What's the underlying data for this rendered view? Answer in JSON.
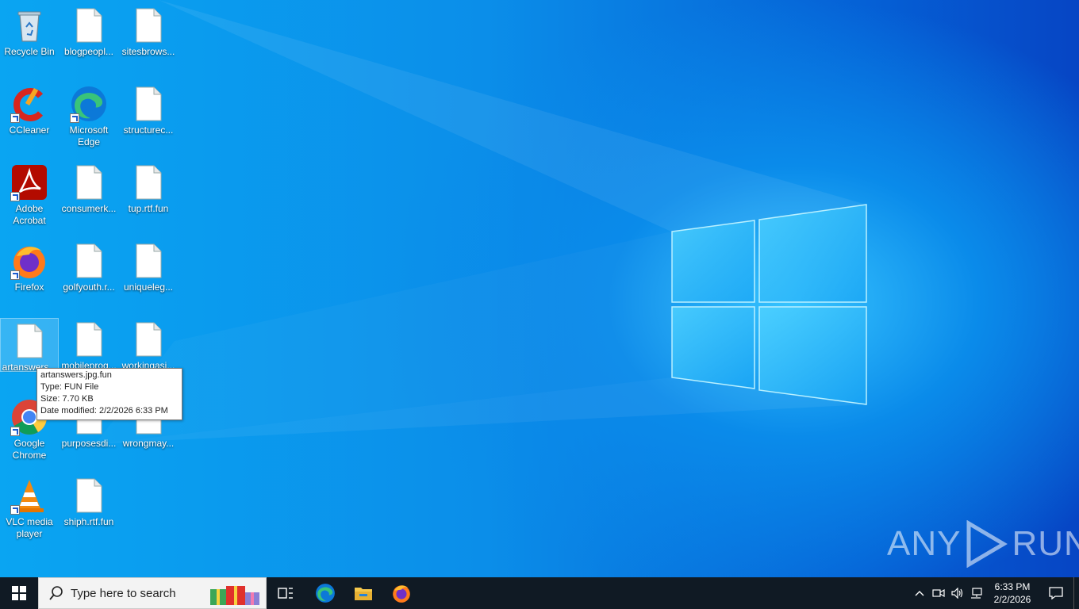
{
  "desktop": {
    "icons": [
      {
        "label": "Recycle Bin"
      },
      {
        "label": "blogpeopl..."
      },
      {
        "label": "sitesbrows..."
      },
      {
        "label": "CCleaner"
      },
      {
        "label": "Microsoft Edge"
      },
      {
        "label": "structurec..."
      },
      {
        "label": "Adobe Acrobat"
      },
      {
        "label": "consumerk..."
      },
      {
        "label": "tup.rtf.fun"
      },
      {
        "label": "Firefox"
      },
      {
        "label": "golfyouth.r..."
      },
      {
        "label": "uniqueleg..."
      },
      {
        "label": "artanswers..."
      },
      {
        "label": "mobileprog..."
      },
      {
        "label": "workingasi..."
      },
      {
        "label": "Google Chrome"
      },
      {
        "label": "purposesdi..."
      },
      {
        "label": "wrongmay..."
      },
      {
        "label": "VLC media player"
      },
      {
        "label": "shiph.rtf.fun"
      }
    ],
    "tooltip": {
      "name": "artanswers.jpg.fun",
      "type": "Type: FUN File",
      "size": "Size: 7.70 KB",
      "modified": "Date modified: 2/2/2026 6:33 PM"
    },
    "watermark": {
      "left": "ANY",
      "right": "RUN"
    }
  },
  "taskbar": {
    "search_placeholder": "Type here to search",
    "clock_time": "6:33 PM",
    "clock_date": "2/2/2026"
  },
  "colors": {
    "taskbar": "#101a24",
    "desktop_accent": "#0a8bea"
  }
}
